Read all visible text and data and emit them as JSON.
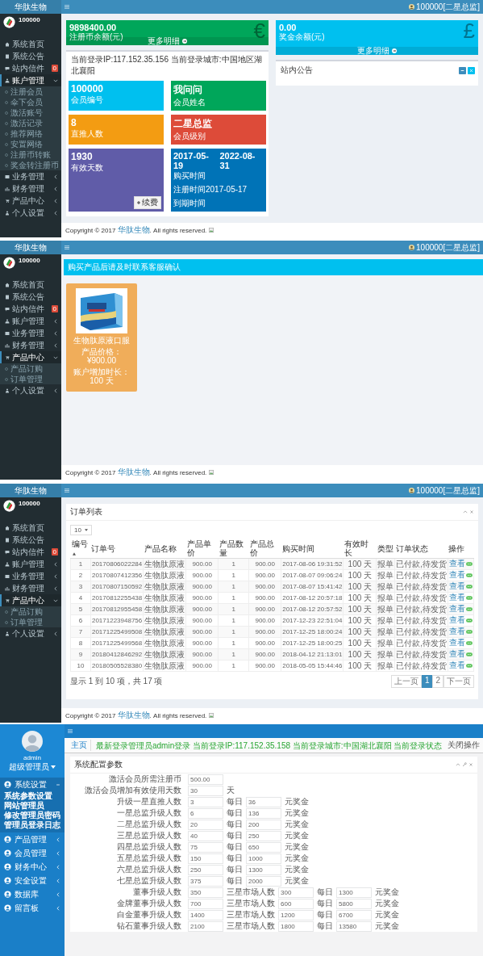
{
  "screens": [
    {
      "kind": "dashboard",
      "sidebar": {
        "kind": "dark",
        "brand": "华肽生物",
        "user": "100000",
        "items": [
          {
            "label": "系统首页"
          },
          {
            "label": "系统公告"
          },
          {
            "label": "站内信件",
            "badge": "0"
          },
          {
            "label": "账户管理",
            "expanded": true,
            "children": [
              {
                "label": "注册会员"
              },
              {
                "label": "伞下会员"
              },
              {
                "label": "激活账号"
              },
              {
                "label": "激活记录"
              },
              {
                "label": "推荐网络"
              },
              {
                "label": "安置网络"
              },
              {
                "label": "注册币转账"
              },
              {
                "label": "奖金转注册币"
              }
            ]
          },
          {
            "label": "业务管理",
            "expanded": false
          },
          {
            "label": "财务管理",
            "expanded": false
          },
          {
            "label": "产品中心",
            "expanded": false
          },
          {
            "label": "个人设置",
            "expanded": false
          }
        ]
      },
      "topbar": {
        "user": "100000[二星总监]"
      },
      "stat_cards": [
        {
          "value": "9898400.00",
          "label": "注册币余额(元)",
          "link": "更多明细",
          "glyph": "€",
          "color": "#00a65a"
        },
        {
          "value": "0.00",
          "label": "奖金余额(元)",
          "link": "更多明细",
          "glyph": "£",
          "color": "#00c0ef"
        }
      ],
      "login_info": "当前登录IP:117.152.35.156 当前登录城市:中国地区湖北襄阳",
      "tiles": [
        {
          "kind": "plain",
          "value": "100000",
          "label": "会员编号",
          "color": "#00c0ef"
        },
        {
          "kind": "plain",
          "value": "我问问",
          "label": "会员姓名",
          "color": "#00a65a"
        },
        {
          "kind": "plain",
          "value": "8",
          "label": "直推人数",
          "color": "#f39c12"
        },
        {
          "kind": "plain",
          "value": "二星总监",
          "label": "会员级别",
          "color": "#dd4b39"
        },
        {
          "kind": "renew",
          "value": "1930",
          "label": "有效天数",
          "button": "续费",
          "color": "#605ca8"
        },
        {
          "kind": "dates",
          "start": "2017-05-19",
          "end": "2022-08-31",
          "start_label": "购买时间",
          "middle": "注册时间2017-05-17",
          "end_label": "到期时间",
          "color": "#0073b7"
        }
      ],
      "notice": {
        "title": "站内公告"
      },
      "footer": {
        "prefix": "Copyright © 2017",
        "link": "华肽生物",
        "suffix": ". All rights reserved."
      }
    },
    {
      "kind": "products",
      "sidebar": {
        "kind": "dark",
        "brand": "华肽生物",
        "user": "100000",
        "items": [
          {
            "label": "系统首页"
          },
          {
            "label": "系统公告"
          },
          {
            "label": "站内信件",
            "badge": "0"
          },
          {
            "label": "账户管理",
            "expanded": false
          },
          {
            "label": "业务管理",
            "expanded": false
          },
          {
            "label": "财务管理",
            "expanded": false
          },
          {
            "label": "产品中心",
            "expanded": true,
            "children": [
              {
                "label": "产品订购"
              },
              {
                "label": "订单管理"
              }
            ]
          },
          {
            "label": "个人设置",
            "expanded": false
          }
        ]
      },
      "topbar": {
        "user": "100000[二星总监]"
      },
      "banner": "购买产品后请及时联系客服确认",
      "products": [
        {
          "name": "生物肽原液口服",
          "price": "产品价格：¥900.00",
          "duration": "账户增加时长：100 天"
        }
      ],
      "footer": {
        "prefix": "Copyright © 2017",
        "link": "华肽生物",
        "suffix": ". All rights reserved."
      }
    },
    {
      "kind": "orders",
      "sidebar": {
        "kind": "dark",
        "brand": "华肽生物",
        "user": "100000",
        "items": [
          {
            "label": "系统首页"
          },
          {
            "label": "系统公告"
          },
          {
            "label": "站内信件",
            "badge": "0"
          },
          {
            "label": "账户管理",
            "expanded": false
          },
          {
            "label": "业务管理",
            "expanded": false
          },
          {
            "label": "财务管理",
            "expanded": false
          },
          {
            "label": "产品中心",
            "expanded": true,
            "children": [
              {
                "label": "产品订购"
              },
              {
                "label": "订单管理"
              }
            ]
          },
          {
            "label": "个人设置",
            "expanded": false
          }
        ]
      },
      "topbar": {
        "user": "100000[二星总监]"
      },
      "title": "订单列表",
      "page_size": "10",
      "columns": [
        {
          "label": "编号",
          "sorted": true
        },
        {
          "label": "订单号",
          "sorted": false
        },
        {
          "label": "产品名称",
          "sorted": false
        },
        {
          "label": "产品单价",
          "sorted": false
        },
        {
          "label": "产品数量",
          "sorted": false
        },
        {
          "label": "产品总价",
          "sorted": false
        },
        {
          "label": "购买时间",
          "sorted": false
        },
        {
          "label": "有效时长",
          "sorted": false
        },
        {
          "label": "类型",
          "sorted": false
        },
        {
          "label": "订单状态",
          "sorted": false
        },
        {
          "label": "操作",
          "sorted": false
        }
      ],
      "rows": [
        {
          "cells": [
            "1",
            "20170806022284",
            "生物肽原液",
            "900.00",
            "1",
            "900.00",
            "2017-08-06 19:31:52",
            "100 天",
            "报单",
            "已付款,待发货"
          ],
          "action": "查看"
        },
        {
          "cells": [
            "2",
            "20170807412356",
            "生物肽原液",
            "900.00",
            "1",
            "900.00",
            "2017-08-07 09:06:24",
            "100 天",
            "报单",
            "已付款,待发货"
          ],
          "action": "查看"
        },
        {
          "cells": [
            "3",
            "20170807150592",
            "生物肽原液",
            "900.00",
            "1",
            "900.00",
            "2017-08-07 15:41:42",
            "100 天",
            "报单",
            "已付款,待发货"
          ],
          "action": "查看"
        },
        {
          "cells": [
            "4",
            "20170812255438",
            "生物肽原液",
            "900.00",
            "1",
            "900.00",
            "2017-08-12 20:57:18",
            "100 天",
            "报单",
            "已付款,待发货"
          ],
          "action": "查看"
        },
        {
          "cells": [
            "5",
            "20170812955458",
            "生物肽原液",
            "900.00",
            "1",
            "900.00",
            "2017-08-12 20:57:52",
            "100 天",
            "报单",
            "已付款,待发货"
          ],
          "action": "查看"
        },
        {
          "cells": [
            "6",
            "20171223948756",
            "生物肽原液",
            "900.00",
            "1",
            "900.00",
            "2017-12-23 22:51:04",
            "100 天",
            "报单",
            "已付款,待发货"
          ],
          "action": "查看"
        },
        {
          "cells": [
            "7",
            "20171225499508",
            "生物肽原液",
            "900.00",
            "1",
            "900.00",
            "2017-12-25 18:00:24",
            "100 天",
            "报单",
            "已付款,待发货"
          ],
          "action": "查看"
        },
        {
          "cells": [
            "8",
            "20171225499568",
            "生物肽原液",
            "900.00",
            "1",
            "900.00",
            "2017-12-25 18:00:25",
            "100 天",
            "报单",
            "已付款,待发货"
          ],
          "action": "查看"
        },
        {
          "cells": [
            "9",
            "20180412846292",
            "生物肽原液",
            "900.00",
            "1",
            "900.00",
            "2018-04-12 21:13:01",
            "100 天",
            "报单",
            "已付款,待发货"
          ],
          "action": "查看"
        },
        {
          "cells": [
            "10",
            "20180505528380",
            "生物肽原液",
            "900.00",
            "1",
            "900.00",
            "2018-05-05 15:44:46",
            "100 天",
            "报单",
            "已付款,待发货"
          ],
          "action": "查看"
        }
      ],
      "info": "显示 1 到 10 项，共 17 项",
      "pages": [
        {
          "label": "上一页",
          "selected": false
        },
        {
          "label": "1",
          "selected": true
        },
        {
          "label": "2",
          "selected": false
        },
        {
          "label": "下一页",
          "selected": false
        }
      ],
      "footer": {
        "prefix": "Copyright © 2017",
        "link": "华肽生物",
        "suffix": ". All rights reserved."
      }
    },
    {
      "kind": "settings",
      "sidebar": {
        "kind": "blue",
        "name": "admin",
        "role": "超级管理员",
        "items": [
          {
            "label": "系统设置",
            "expanded": true,
            "children": [
              {
                "label": "系统参数设置"
              },
              {
                "label": "网站管理员"
              },
              {
                "label": "修改管理员密码"
              },
              {
                "label": "管理员登录日志"
              }
            ]
          },
          {
            "label": "产品管理",
            "expanded": false
          },
          {
            "label": "会员管理",
            "expanded": false
          },
          {
            "label": "财务中心",
            "expanded": false
          },
          {
            "label": "安全设置",
            "expanded": false
          },
          {
            "label": "数据库",
            "expanded": false
          },
          {
            "label": "留言板",
            "expanded": false
          }
        ]
      },
      "breadcrumb": {
        "tab": "主页",
        "message": "最新登录管理员admin登录 当前登录IP:117.152.35.158 当前登录城市:中国湖北襄阳 当前登录状态",
        "right": "关闭操作"
      },
      "title": "系统配置参数",
      "rows": [
        {
          "label": "激活会员所需注册币",
          "cells": [
            {
              "kind": "field",
              "value": "500.00"
            }
          ]
        },
        {
          "label": "激活会员增加有效使用天数",
          "cells": [
            {
              "kind": "field",
              "value": "30"
            },
            {
              "kind": "text",
              "text": "天"
            }
          ]
        },
        {
          "label": "升级一星直推人数",
          "cells": [
            {
              "kind": "field",
              "value": "3"
            },
            {
              "kind": "text",
              "text": "每日"
            },
            {
              "kind": "field",
              "value": "36"
            },
            {
              "kind": "text",
              "text": "元奖金"
            }
          ]
        },
        {
          "label": "一星总监升级人数",
          "cells": [
            {
              "kind": "field",
              "value": "6"
            },
            {
              "kind": "text",
              "text": "每日"
            },
            {
              "kind": "field",
              "value": "136"
            },
            {
              "kind": "text",
              "text": "元奖金"
            }
          ]
        },
        {
          "label": "二星总监升级人数",
          "cells": [
            {
              "kind": "field",
              "value": "20"
            },
            {
              "kind": "text",
              "text": "每日"
            },
            {
              "kind": "field",
              "value": "200"
            },
            {
              "kind": "text",
              "text": "元奖金"
            }
          ]
        },
        {
          "label": "三星总监升级人数",
          "cells": [
            {
              "kind": "field",
              "value": "40"
            },
            {
              "kind": "text",
              "text": "每日"
            },
            {
              "kind": "field",
              "value": "250"
            },
            {
              "kind": "text",
              "text": "元奖金"
            }
          ]
        },
        {
          "label": "四星总监升级人数",
          "cells": [
            {
              "kind": "field",
              "value": "75"
            },
            {
              "kind": "text",
              "text": "每日"
            },
            {
              "kind": "field",
              "value": "650"
            },
            {
              "kind": "text",
              "text": "元奖金"
            }
          ]
        },
        {
          "label": "五星总监升级人数",
          "cells": [
            {
              "kind": "field",
              "value": "150"
            },
            {
              "kind": "text",
              "text": "每日"
            },
            {
              "kind": "field",
              "value": "1000"
            },
            {
              "kind": "text",
              "text": "元奖金"
            }
          ]
        },
        {
          "label": "六星总监升级人数",
          "cells": [
            {
              "kind": "field",
              "value": "250"
            },
            {
              "kind": "text",
              "text": "每日"
            },
            {
              "kind": "field",
              "value": "1300"
            },
            {
              "kind": "text",
              "text": "元奖金"
            }
          ]
        },
        {
          "label": "七星总监升级人数",
          "cells": [
            {
              "kind": "field",
              "value": "375"
            },
            {
              "kind": "text",
              "text": "每日"
            },
            {
              "kind": "field",
              "value": "2000"
            },
            {
              "kind": "text",
              "text": "元奖金"
            }
          ]
        },
        {
          "label": "董事升级人数",
          "cells": [
            {
              "kind": "field",
              "value": "350"
            },
            {
              "kind": "text",
              "text": "三星市场人数"
            },
            {
              "kind": "field",
              "value": "300"
            },
            {
              "kind": "text",
              "text": "每日"
            },
            {
              "kind": "field",
              "value": "1300"
            },
            {
              "kind": "text",
              "text": "元奖金"
            }
          ]
        },
        {
          "label": "金牌董事升级人数",
          "cells": [
            {
              "kind": "field",
              "value": "700"
            },
            {
              "kind": "text",
              "text": "三星市场人数"
            },
            {
              "kind": "field",
              "value": "600"
            },
            {
              "kind": "text",
              "text": "每日"
            },
            {
              "kind": "field",
              "value": "5800"
            },
            {
              "kind": "text",
              "text": "元奖金"
            }
          ]
        },
        {
          "label": "白金董事升级人数",
          "cells": [
            {
              "kind": "field",
              "value": "1400"
            },
            {
              "kind": "text",
              "text": "三星市场人数"
            },
            {
              "kind": "field",
              "value": "1200"
            },
            {
              "kind": "text",
              "text": "每日"
            },
            {
              "kind": "field",
              "value": "6700"
            },
            {
              "kind": "text",
              "text": "元奖金"
            }
          ]
        },
        {
          "label": "钻石董事升级人数",
          "cells": [
            {
              "kind": "field",
              "value": "2100"
            },
            {
              "kind": "text",
              "text": "三星市场人数"
            },
            {
              "kind": "field",
              "value": "1800"
            },
            {
              "kind": "text",
              "text": "每日"
            },
            {
              "kind": "field",
              "value": "13580"
            },
            {
              "kind": "text",
              "text": "元奖金"
            }
          ]
        }
      ]
    }
  ]
}
